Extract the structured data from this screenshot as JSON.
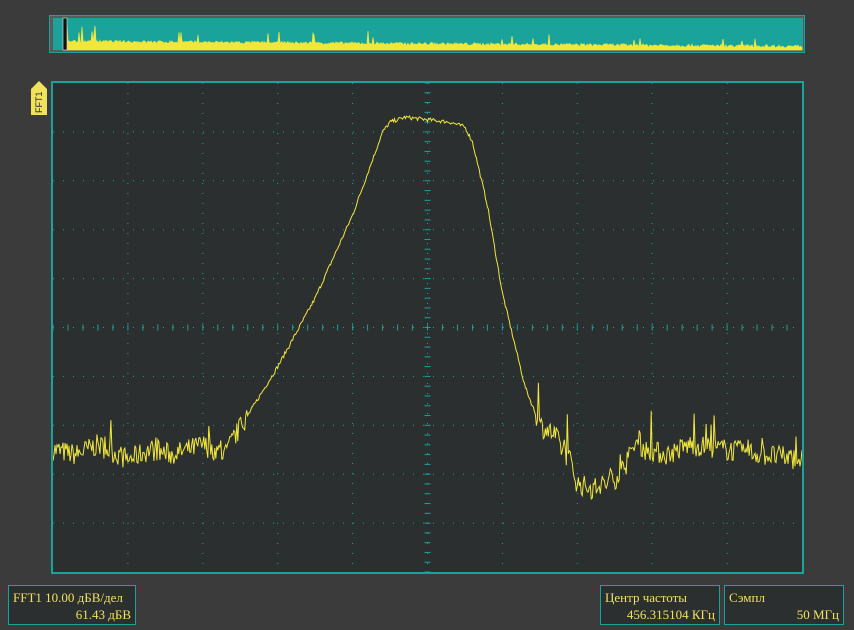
{
  "overview": {
    "colors": {
      "background": "#1aa39b",
      "trace": "#f0e63c",
      "marker": "#111111"
    }
  },
  "screen": {
    "channel_marker": "FFT1",
    "colors": {
      "grid": "#1aa39b",
      "trace": "#f0e63c",
      "background": "#2b2f2f"
    },
    "grid": {
      "divisions_x": 10,
      "divisions_y": 10
    }
  },
  "channel_panel": {
    "label": "FFT1",
    "scale": "10.00 дБВ/дел",
    "offset": "61.43 дБВ"
  },
  "center_panel": {
    "label": "Центр частоты",
    "value": "456.315104 КГц"
  },
  "sample_panel": {
    "label": "Сэмпл",
    "value": "50 МГц"
  },
  "chart_data": {
    "type": "line",
    "title": "",
    "xlabel": "",
    "ylabel": "",
    "x_divisions": [
      0,
      10
    ],
    "y_divisions": [
      0,
      10
    ],
    "grid": true,
    "series": [
      {
        "x": [
          0,
          0.3,
          0.6,
          1.0,
          1.3,
          1.6,
          2.0,
          2.3,
          2.4,
          3.0,
          3.5,
          4.0,
          4.4,
          4.5,
          4.7,
          5.0,
          5.3,
          5.5,
          5.6,
          5.8,
          6.0,
          6.3,
          6.5,
          6.7,
          6.8,
          6.9,
          7.0,
          7.2,
          7.3,
          7.5,
          7.6,
          7.65,
          7.7,
          7.8,
          7.9,
          8.2,
          8.5,
          9.0,
          9.5,
          10
        ],
        "y": [
          2.5,
          2.4,
          2.6,
          2.3,
          2.5,
          2.4,
          2.6,
          2.4,
          2.7,
          4.2,
          5.6,
          7.3,
          9.0,
          9.2,
          9.3,
          9.25,
          9.2,
          9.1,
          8.8,
          7.5,
          5.7,
          3.8,
          3.0,
          2.8,
          2.5,
          2.3,
          1.8,
          1.7,
          1.75,
          1.9,
          2.1,
          2.2,
          2.3,
          2.7,
          2.5,
          2.4,
          2.6,
          2.5,
          2.4,
          2.3
        ]
      }
    ]
  }
}
